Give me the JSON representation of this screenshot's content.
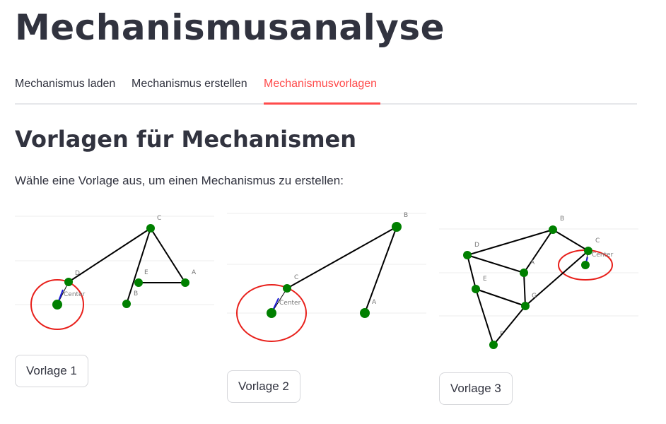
{
  "page": {
    "title": "Mechanismusanalyse"
  },
  "tabs": [
    {
      "label": "Mechanismus laden",
      "active": false
    },
    {
      "label": "Mechanismus erstellen",
      "active": false
    },
    {
      "label": "Mechanismusvorlagen",
      "active": true
    }
  ],
  "section": {
    "title": "Vorlagen für Mechanismen",
    "intro": "Wähle eine Vorlage aus, um einen Mechanismus zu erstellen:"
  },
  "colors": {
    "accent": "#ff4b4b",
    "joint": "#008000",
    "link": "#000000",
    "circle": "#e8201b",
    "vector": "#1a1ad6"
  },
  "templates": [
    {
      "button_label": "Vorlage 1",
      "center_label": "Center",
      "joints": [
        {
          "label": "A"
        },
        {
          "label": "B"
        },
        {
          "label": "C"
        },
        {
          "label": "D"
        },
        {
          "label": "E"
        }
      ]
    },
    {
      "button_label": "Vorlage 2",
      "center_label": "Center",
      "joints": [
        {
          "label": "A"
        },
        {
          "label": "B"
        },
        {
          "label": "C"
        }
      ]
    },
    {
      "button_label": "Vorlage 3",
      "center_label": "Center",
      "joints": [
        {
          "label": "A"
        },
        {
          "label": "B"
        },
        {
          "label": "C"
        },
        {
          "label": "D"
        },
        {
          "label": "E"
        },
        {
          "label": "F"
        },
        {
          "label": "G"
        }
      ]
    }
  ]
}
